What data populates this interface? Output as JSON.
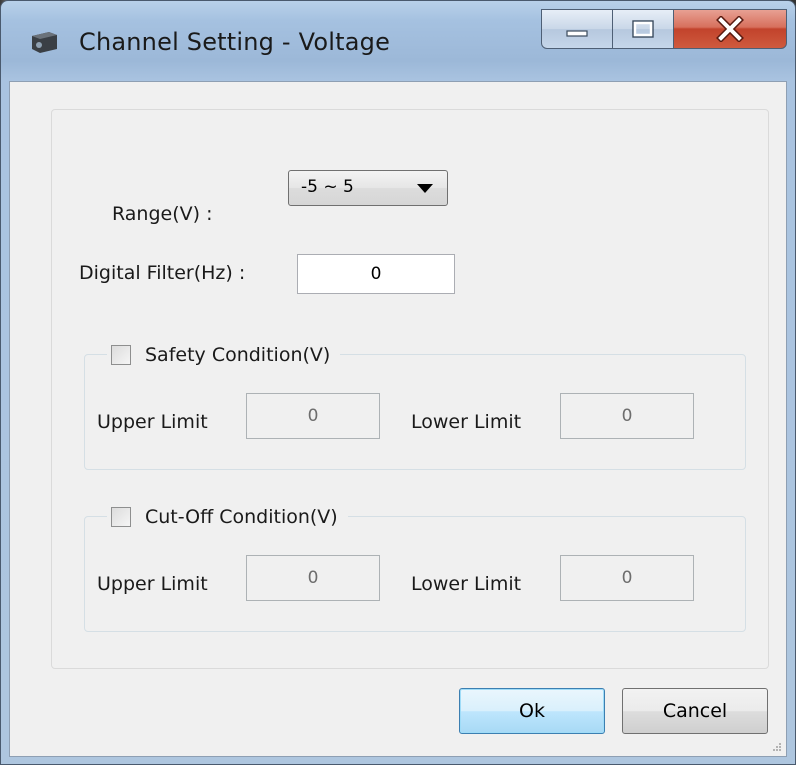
{
  "window": {
    "title": "Channel Setting - Voltage"
  },
  "form": {
    "range_label": "Range(V) :",
    "range_value": "-5 ~ 5",
    "filter_label": "Digital Filter(Hz) :",
    "filter_value": "0"
  },
  "safety": {
    "legend": "Safety Condition(V)",
    "upper_label": "Upper Limit",
    "upper_value": "0",
    "lower_label": "Lower Limit",
    "lower_value": "0"
  },
  "cutoff": {
    "legend": "Cut-Off Condition(V)",
    "upper_label": "Upper Limit",
    "upper_value": "0",
    "lower_label": "Lower Limit",
    "lower_value": "0"
  },
  "buttons": {
    "ok_label": "Ok",
    "cancel_label": "Cancel"
  }
}
